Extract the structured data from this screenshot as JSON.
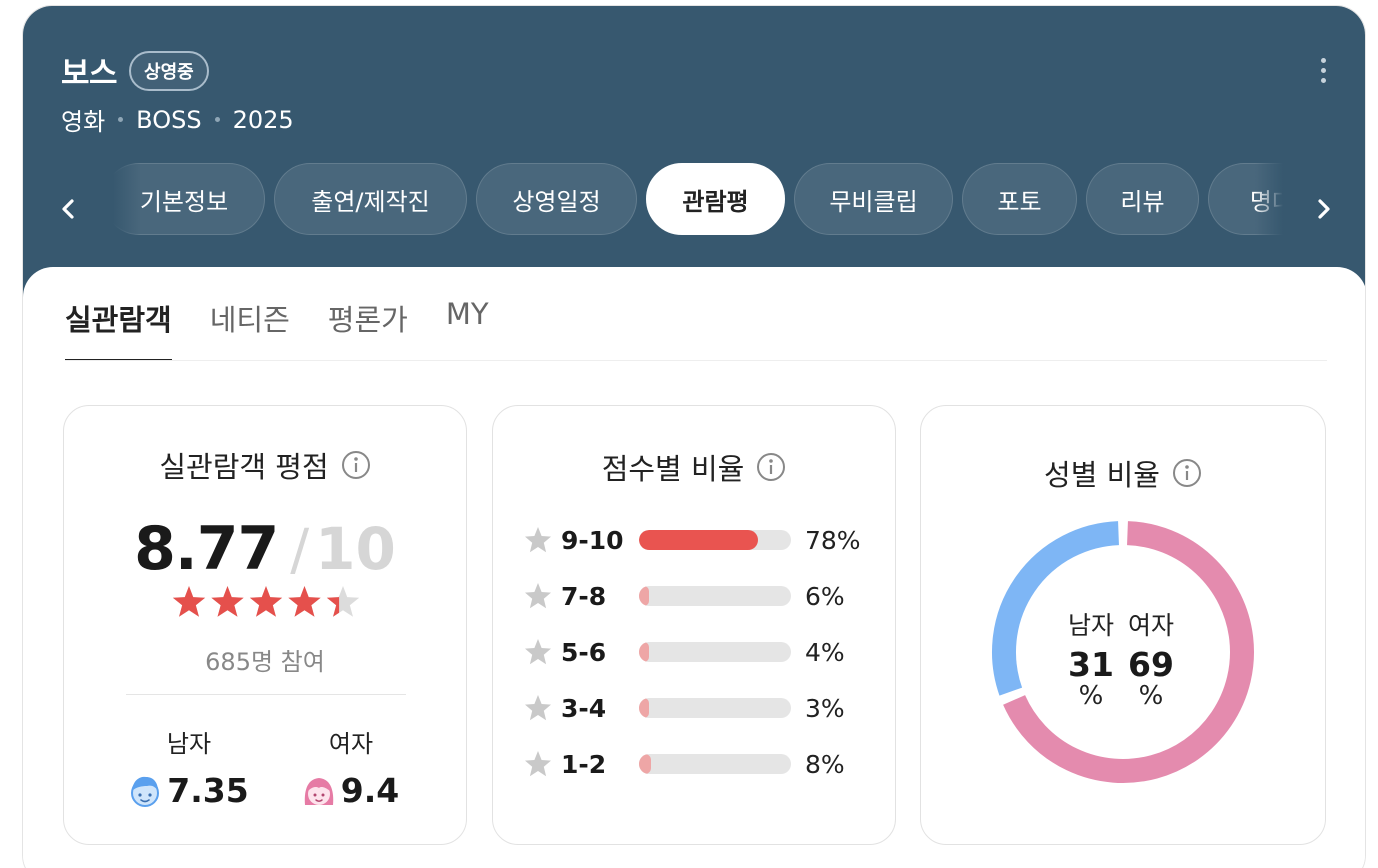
{
  "header": {
    "title": "보스",
    "status_badge": "상영중",
    "meta": [
      "영화",
      "BOSS",
      "2025"
    ],
    "tabs": [
      {
        "label": "기본정보",
        "active": false
      },
      {
        "label": "출연/제작진",
        "active": false
      },
      {
        "label": "상영일정",
        "active": false
      },
      {
        "label": "관람평",
        "active": true
      },
      {
        "label": "무비클립",
        "active": false
      },
      {
        "label": "포토",
        "active": false
      },
      {
        "label": "리뷰",
        "active": false
      },
      {
        "label": "명대사",
        "active": false
      }
    ],
    "colors": {
      "background": "#37586f"
    }
  },
  "subtabs": [
    {
      "label": "실관람객",
      "active": true
    },
    {
      "label": "네티즌",
      "active": false
    },
    {
      "label": "평론가",
      "active": false
    },
    {
      "label": "MY",
      "active": false
    }
  ],
  "rating": {
    "title": "실관람객 평점",
    "score": "8.77",
    "slash": "/",
    "max": "10",
    "stars_value": 4.385,
    "stars_max": 5,
    "participants": "685명 참여",
    "male_label": "남자",
    "male_score": "7.35",
    "female_label": "여자",
    "female_score": "9.4",
    "star_color": "#e5504c"
  },
  "distribution": {
    "title": "점수별 비율",
    "rows": [
      {
        "label": "9-10",
        "percent": 78,
        "percent_text": "78%",
        "color": "#e95450"
      },
      {
        "label": "7-8",
        "percent": 6,
        "percent_text": "6%",
        "color": "#eea6a6"
      },
      {
        "label": "5-6",
        "percent": 4,
        "percent_text": "4%",
        "color": "#eea6a6"
      },
      {
        "label": "3-4",
        "percent": 3,
        "percent_text": "3%",
        "color": "#eea6a6"
      },
      {
        "label": "1-2",
        "percent": 8,
        "percent_text": "8%",
        "color": "#eea6a6"
      }
    ]
  },
  "gender": {
    "title": "성별 비율",
    "male_label": "남자",
    "male_value": "31",
    "female_label": "여자",
    "female_value": "69",
    "unit": "%",
    "male_fraction": 0.31,
    "female_fraction": 0.69,
    "male_color": "#7eb6f5",
    "female_color": "#e48bae"
  }
}
